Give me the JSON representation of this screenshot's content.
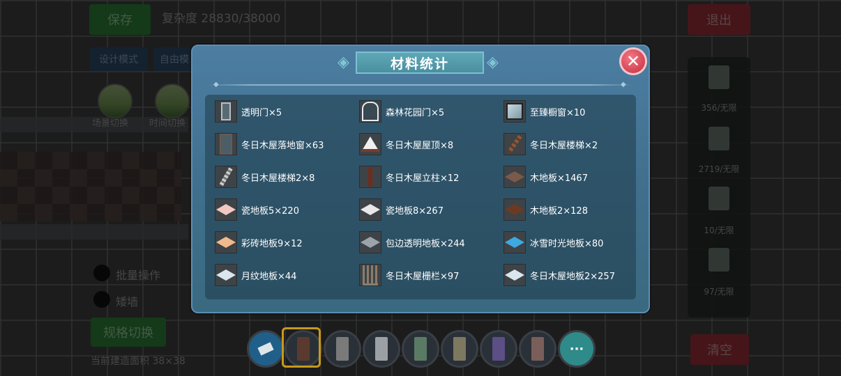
{
  "background": {
    "save_label": "保存",
    "complexity_label": "复杂度 28830/38000",
    "exit_label": "退出",
    "design_mode_label": "设计模式",
    "free_mode_label": "自由模",
    "scene_switch_label": "场景切换",
    "time_switch_label": "时间切换",
    "batch_label": "批量操作",
    "short_wall_label": "矮墙",
    "spec_switch_label": "规格切换",
    "area_label": "当前建造面积 38×38",
    "clear_label": "清空",
    "counts": [
      "356/无限",
      "2719/无限",
      "10/无限",
      "97/无限"
    ],
    "more_label": "···"
  },
  "dialog": {
    "title": "材料统计",
    "close_glyph": "✕",
    "items": [
      {
        "label": "透明门×5",
        "icon": "door-icon"
      },
      {
        "label": "森林花园门×5",
        "icon": "arch-door-icon"
      },
      {
        "label": "至臻橱窗×10",
        "icon": "window-icon"
      },
      {
        "label": "冬日木屋落地窗×63",
        "icon": "tall-window-icon"
      },
      {
        "label": "冬日木屋屋顶×8",
        "icon": "roof-icon"
      },
      {
        "label": "冬日木屋楼梯×2",
        "icon": "stair-icon"
      },
      {
        "label": "冬日木屋楼梯2×8",
        "icon": "stair-icon"
      },
      {
        "label": "冬日木屋立柱×12",
        "icon": "pillar-icon"
      },
      {
        "label": "木地板×1467",
        "icon": "floor-tile-icon"
      },
      {
        "label": "瓷地板5×220",
        "icon": "floor-tile-icon"
      },
      {
        "label": "瓷地板8×267",
        "icon": "floor-tile-icon"
      },
      {
        "label": "木地板2×128",
        "icon": "floor-tile-icon"
      },
      {
        "label": "彩砖地板9×12",
        "icon": "floor-tile-icon"
      },
      {
        "label": "包边透明地板×244",
        "icon": "floor-tile-icon"
      },
      {
        "label": "冰雪时光地板×80",
        "icon": "floor-tile-icon"
      },
      {
        "label": "月纹地板×44",
        "icon": "floor-tile-icon"
      },
      {
        "label": "冬日木屋栅栏×97",
        "icon": "fence-icon"
      },
      {
        "label": "冬日木屋地板2×257",
        "icon": "floor-tile-icon"
      }
    ]
  },
  "colors": {
    "tile_wood": "#7a5a4a",
    "tile_pink": "#f2c8c2",
    "tile_white": "#e8e8e8",
    "tile_darkwood": "#6b3a25",
    "tile_peach": "#f1b98e",
    "tile_grey": "#9aa4aa",
    "tile_ice": "#3fa8e0",
    "tile_moon": "#dbe5ee",
    "tile_pale": "#d9e6ee"
  }
}
